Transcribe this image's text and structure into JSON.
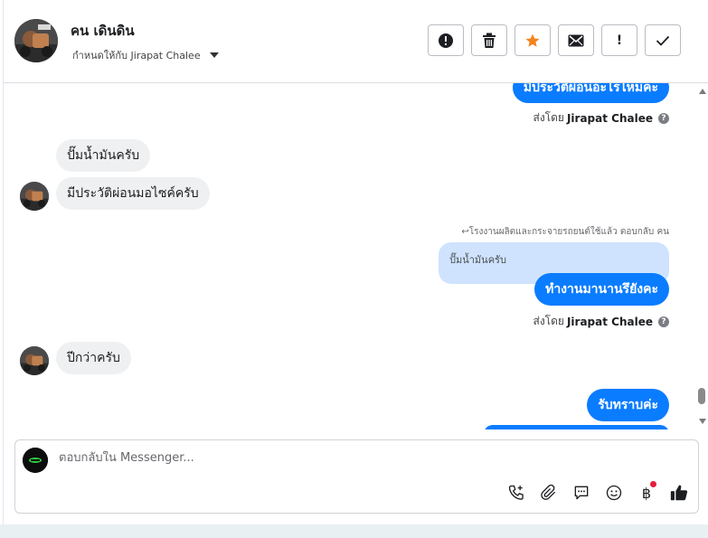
{
  "header": {
    "contact_name": "คน เดินดิน",
    "assigned_to": "กำหนดให้กับ Jirapat Chalee"
  },
  "actions": [
    {
      "name": "report-button",
      "icon": "alert-circle-icon",
      "glyph": "!"
    },
    {
      "name": "delete-button",
      "icon": "trash-icon",
      "glyph": ""
    },
    {
      "name": "star-button",
      "icon": "star-icon",
      "glyph": "★"
    },
    {
      "name": "mail-button",
      "icon": "envelope-icon",
      "glyph": ""
    },
    {
      "name": "spam-button",
      "icon": "exclamation-icon",
      "glyph": "!"
    },
    {
      "name": "done-button",
      "icon": "check-icon",
      "glyph": "✓"
    }
  ],
  "messages": {
    "out_1": "มีประวัติผ่อนอะไรไหมคะ",
    "sent_by_prefix": "ส่งโดย",
    "sent_by_name": "Jirapat Chalee",
    "in_1": "ปั๊มน้ำมันครับ",
    "in_2": "มีประวัติผ่อนมอไซค์ครับ",
    "reply_note": "↩โรงงานผลิตและกระจายรถยนต์ใช้แล้ว ตอบกลับ คน",
    "quoted_text": "ปั๊มน้ำมันครับ",
    "out_2": "ทำงานมานานรึยังคะ",
    "in_3": "ปีกว่าครับ",
    "out_3": "รับทราบค่ะ"
  },
  "composer": {
    "placeholder": "ตอบกลับใน Messenger...",
    "value": ""
  },
  "tools": [
    "phone-add-icon",
    "paperclip-icon",
    "chat-bubble-icon",
    "emoji-icon",
    "baht-icon",
    "thumbs-up-icon"
  ],
  "colors": {
    "accent": "#0a7cff",
    "incoming_bubble": "#eff0f2",
    "quoted_bubble": "#cfe3fe",
    "star": "#f5841f",
    "notification_dot": "#e41e3f"
  }
}
